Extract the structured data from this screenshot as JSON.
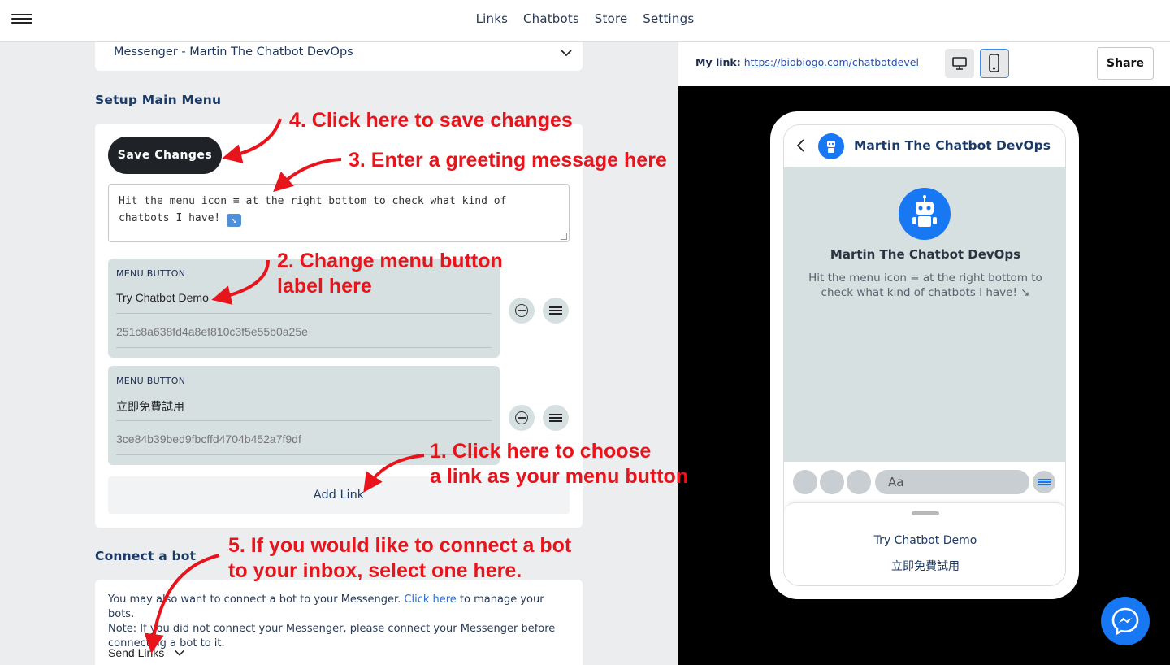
{
  "nav": {
    "items": [
      "Links",
      "Chatbots",
      "Store",
      "Settings"
    ]
  },
  "messenger_select": {
    "value": "Messenger - Martin The Chatbot DevOps"
  },
  "setup_menu": {
    "title": "Setup Main Menu",
    "save_label": "Save Changes",
    "greeting": "Hit the menu icon ≡ at the right bottom to check what kind of chatbots I have!",
    "greeting_emoji": "↘",
    "menu_buttons": [
      {
        "label": "MENU BUTTON",
        "value": "Try Chatbot Demo",
        "id": "251c8a638fd4a8ef810c3f5e55b0a25e"
      },
      {
        "label": "MENU BUTTON",
        "value": "立即免費試用",
        "id": "3ce84b39bed9fbcffd4704b452a7f9df"
      }
    ],
    "add_link_label": "Add Link"
  },
  "connect_bot": {
    "title": "Connect a bot",
    "text_before_link": "You may also want to connect a bot to your Messenger. ",
    "link_text": "Click here",
    "text_after_link": " to manage your bots.",
    "note": "Note: If you did not connect your Messenger, please connect your Messenger before connecting a bot to it.",
    "select_value": "Send Links"
  },
  "preview_header": {
    "my_link_label": "My link:",
    "my_link_url": "https://biobiogo.com/chatbotdevel",
    "share_label": "Share"
  },
  "phone": {
    "chat_title": "Martin The Chatbot DevOps",
    "bot_name": "Martin The Chatbot DevOps",
    "greeting": "Hit the menu icon ≡ at the right bottom to check what kind of chatbots I have! ↘",
    "composer_placeholder": "Aa",
    "drawer_items": [
      "Try Chatbot Demo",
      "立即免費試用"
    ]
  },
  "annotations": {
    "step4": "4. Click here to save changes",
    "step3": "3. Enter a greeting message here",
    "step2_line1": "2. Change menu button",
    "step2_line2": "label here",
    "step1_line1": "1. Click here to choose",
    "step1_line2": "a link as your menu button",
    "step5_line1": "5. If you would like to connect a bot",
    "step5_line2": "to your inbox, select one here."
  },
  "colors": {
    "accent": "#1877f2",
    "annotation": "#e8141c",
    "save_button": "#1f2227",
    "menu_button_bg": "#d6e0e0"
  }
}
